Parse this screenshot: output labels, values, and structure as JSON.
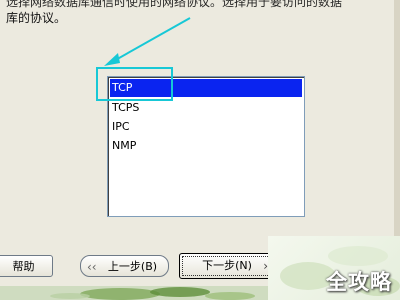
{
  "description": {
    "line1": "选择网络数据库通信时使用的网络协议。选择用于要访问的数据",
    "line2": "库的协议。"
  },
  "protocols": {
    "items": [
      {
        "label": "TCP",
        "selected": true
      },
      {
        "label": "TCPS",
        "selected": false
      },
      {
        "label": "IPC",
        "selected": false
      },
      {
        "label": "NMP",
        "selected": false
      }
    ]
  },
  "buttons": {
    "help": "帮助",
    "back": "上一步(B)",
    "next": "下一步(N)"
  },
  "watermark": "全攻略",
  "colors": {
    "selection": "#0a24f0",
    "highlight": "#17c8d6"
  }
}
